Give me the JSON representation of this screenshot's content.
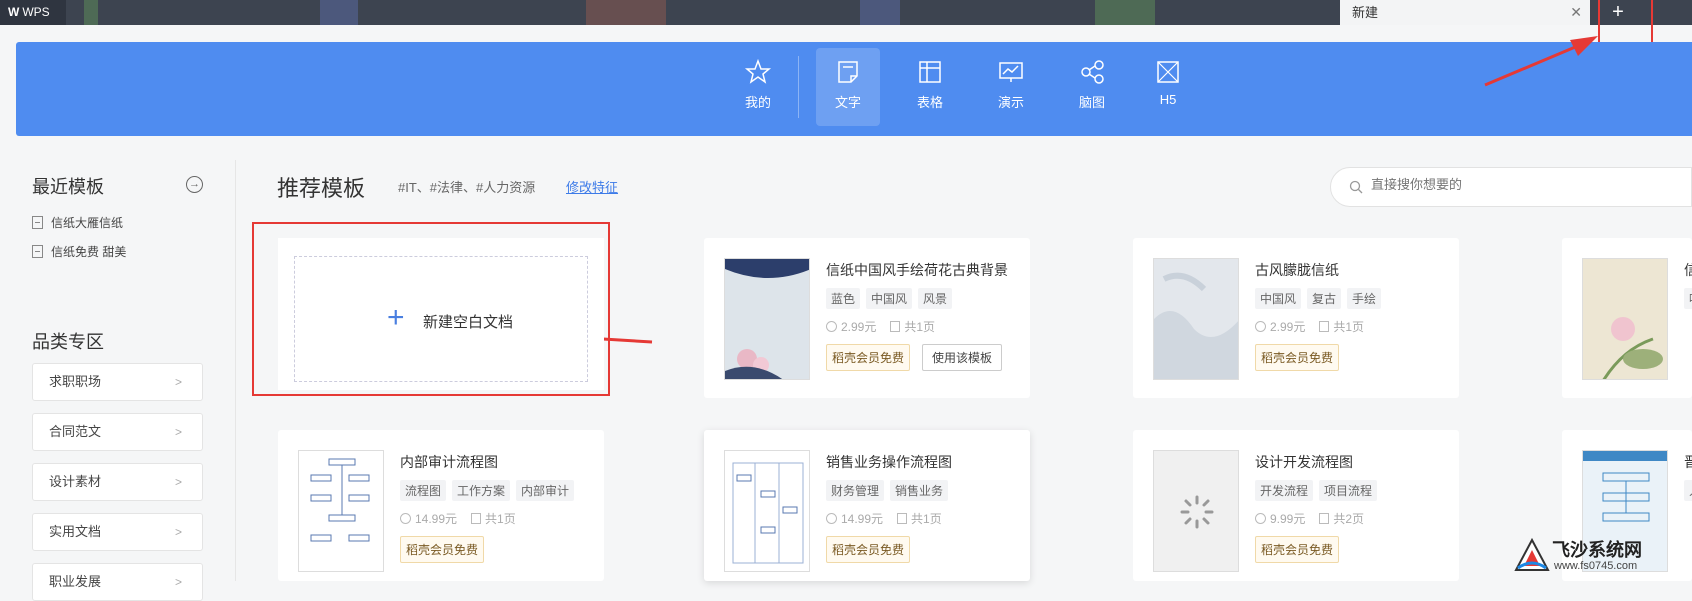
{
  "titlebar": {
    "app_name": "WPS",
    "app_logo_glyph": "W",
    "active_tab": "新建",
    "close_glyph": "✕",
    "add_glyph": "+"
  },
  "topnav": {
    "background": "#4f8cf0",
    "items": [
      {
        "label": "我的",
        "icon": "star-icon"
      },
      {
        "label": "文字",
        "icon": "document-icon",
        "active": true
      },
      {
        "label": "表格",
        "icon": "table-icon"
      },
      {
        "label": "演示",
        "icon": "presentation-icon"
      },
      {
        "label": "脑图",
        "icon": "mindmap-icon"
      },
      {
        "label": "H5",
        "icon": "h5-icon"
      }
    ]
  },
  "sidebar": {
    "recent_title": "最近模板",
    "recent_items": [
      "信纸大雁信纸",
      "信纸免费 甜美"
    ],
    "category_title": "品类专区",
    "categories": [
      "求职职场",
      "合同范文",
      "设计素材",
      "实用文档",
      "职业发展"
    ]
  },
  "main": {
    "title": "推荐模板",
    "tags_hint": "#IT、#法律、#人力资源",
    "edit_link": "修改特征",
    "search_placeholder": "直接搜你想要的",
    "blank_doc_label": "新建空白文档",
    "blank_doc_plus": "+",
    "templates": [
      {
        "title": "信纸中国风手绘荷花古典背景",
        "tags": [
          "蓝色",
          "中国风",
          "风景"
        ],
        "price": "2.99元",
        "pages": "共1页",
        "badge": "稻壳会员免费",
        "use_button": "使用该模板"
      },
      {
        "title": "古风朦胧信纸",
        "tags": [
          "中国风",
          "复古",
          "手绘"
        ],
        "price": "2.99元",
        "pages": "共1页",
        "badge": "稻壳会员免费"
      },
      {
        "title": "信",
        "tags": [
          "唯"
        ],
        "price": "",
        "pages": "",
        "badge": ""
      },
      {
        "title": "内部审计流程图",
        "tags": [
          "流程图",
          "工作方案",
          "内部审计"
        ],
        "price": "14.99元",
        "pages": "共1页",
        "badge": "稻壳会员免费"
      },
      {
        "title": "销售业务操作流程图",
        "tags": [
          "财务管理",
          "销售业务"
        ],
        "price": "14.99元",
        "pages": "共1页",
        "badge": "稻壳会员免费"
      },
      {
        "title": "设计开发流程图",
        "tags": [
          "开发流程",
          "项目流程"
        ],
        "price": "9.99元",
        "pages": "共2页",
        "badge": "稻壳会员免费"
      },
      {
        "title": "晋",
        "tags": [
          "人"
        ],
        "price": "",
        "pages": "",
        "badge": ""
      }
    ]
  },
  "watermark": {
    "title": "飞沙系统网",
    "url": "www.fs0745.com"
  },
  "annotation_color": "#e53935"
}
